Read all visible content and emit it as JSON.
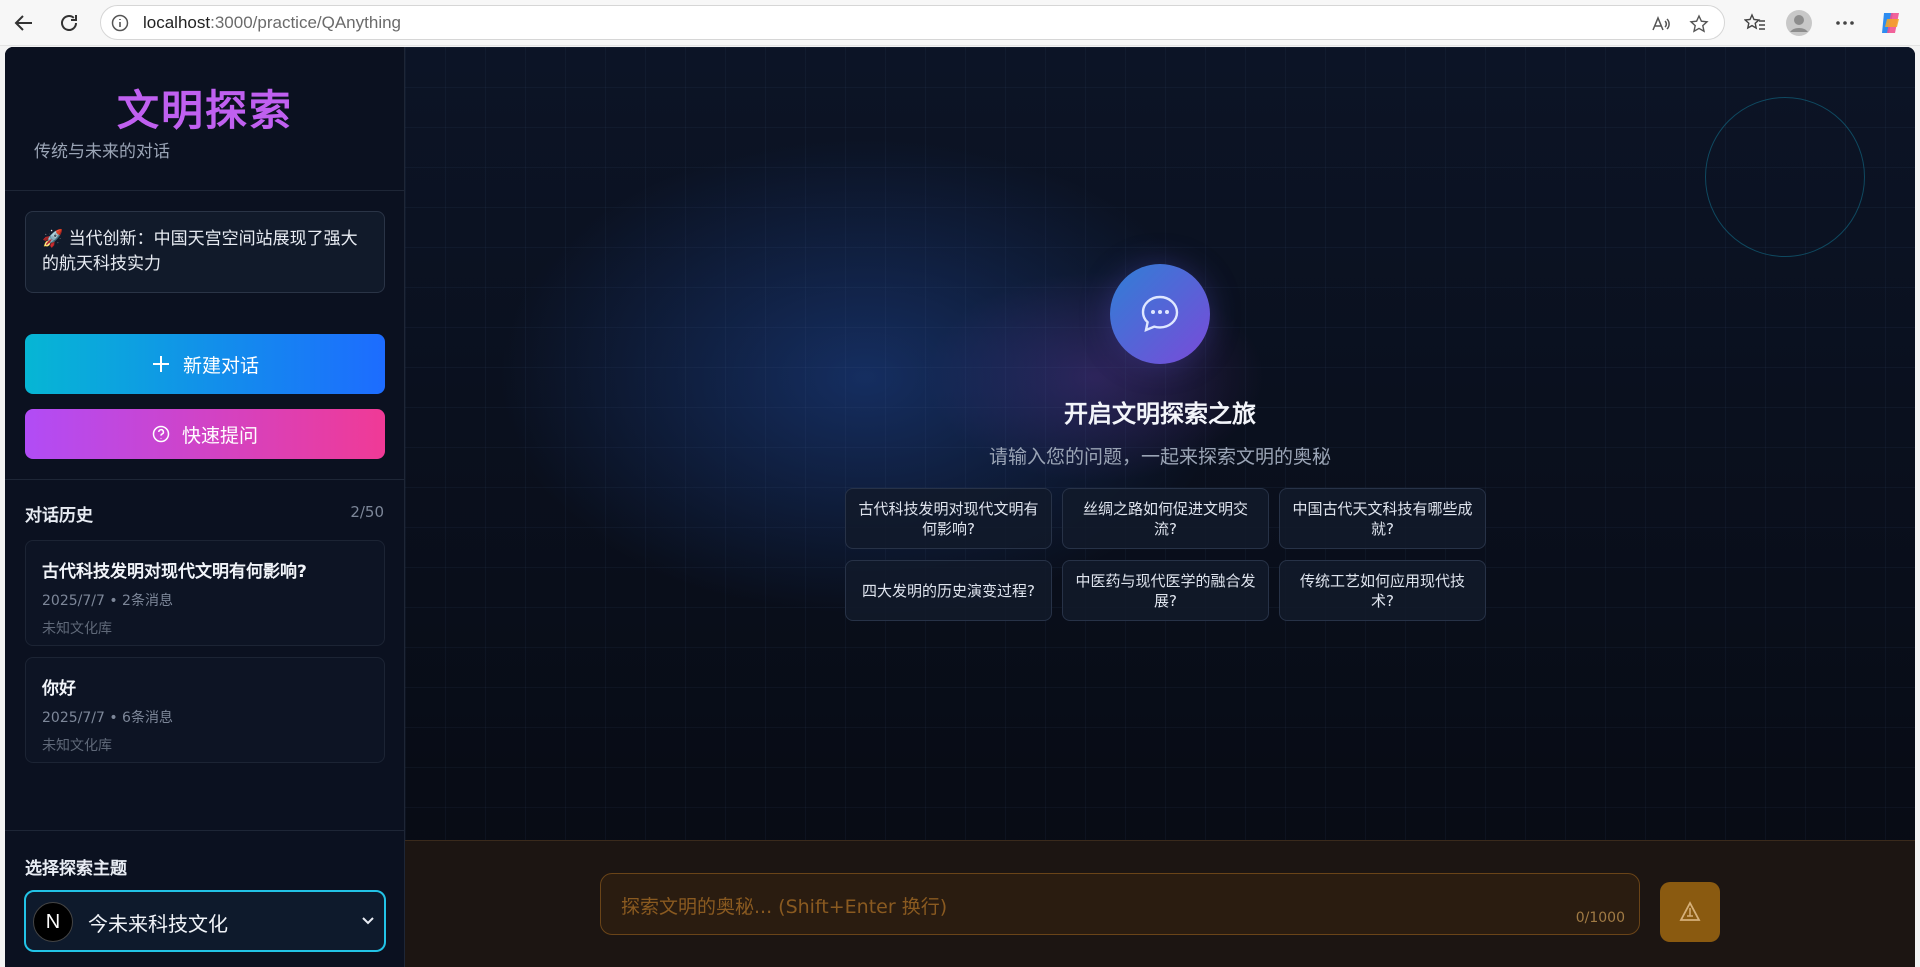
{
  "browser": {
    "url_host": "localhost",
    "url_path": ":3000/practice/QAnything"
  },
  "sidebar": {
    "brand": "文明探索",
    "brand_sub": "传统与未来的对话",
    "notice": "🚀 当代创新：中国天宫空间站展现了强大的航天科技实力",
    "new_chat_label": "新建对话",
    "quick_ask_label": "快速提问",
    "history_title": "对话历史",
    "history_count": "2/50",
    "history": [
      {
        "title": "古代科技发明对现代文明有何影响?",
        "meta": "2025/7/7 • 2条消息",
        "kb": "未知文化库"
      },
      {
        "title": "你好",
        "meta": "2025/7/7 • 6条消息",
        "kb": "未知文化库"
      }
    ],
    "theme_title": "选择探索主题",
    "theme_value": "今未来科技文化",
    "n_badge": "N"
  },
  "main": {
    "welcome_title": "开启文明探索之旅",
    "welcome_sub": "请输入您的问题，一起来探索文明的奥秘",
    "suggestions": [
      "古代科技发明对现代文明有何影响?",
      "丝绸之路如何促进文明交流?",
      "中国古代天文科技有哪些成就?",
      "四大发明的历史演变过程?",
      "中医药与现代医学的融合发展?",
      "传统工艺如何应用现代技术?"
    ],
    "input_placeholder": "探索文明的奥秘... (Shift+Enter 换行)",
    "char_count": "0/1000"
  },
  "colors": {
    "accent_cyan": "#06b6d4",
    "accent_blue": "#1d6cff",
    "accent_purple": "#b14cf6",
    "accent_pink": "#f03a96",
    "send_amber": "#8a5a10"
  }
}
